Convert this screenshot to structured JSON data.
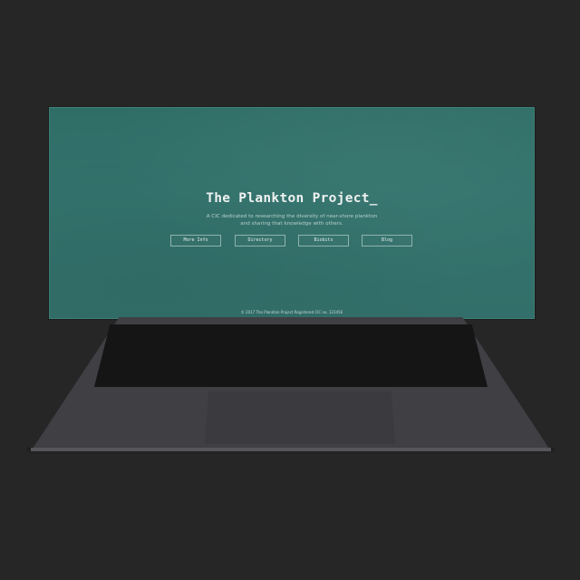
{
  "site": {
    "title": "The Plankton Project_",
    "subtitle_line1": "A CIC dedicated to researching the diversity of near-shore plankton",
    "subtitle_line2": "and sharing that knowledge with others.",
    "nav": [
      {
        "label": "More Info"
      },
      {
        "label": "Directory"
      },
      {
        "label": "Biobits"
      },
      {
        "label": "Blog"
      }
    ],
    "footer": "© 2017 The Plankton Project Registered CIC no. 123456"
  },
  "colors": {
    "background": "#262626",
    "screen_teal": "#33736d",
    "laptop_body": "#3f3f44",
    "keyboard": "#151515"
  }
}
